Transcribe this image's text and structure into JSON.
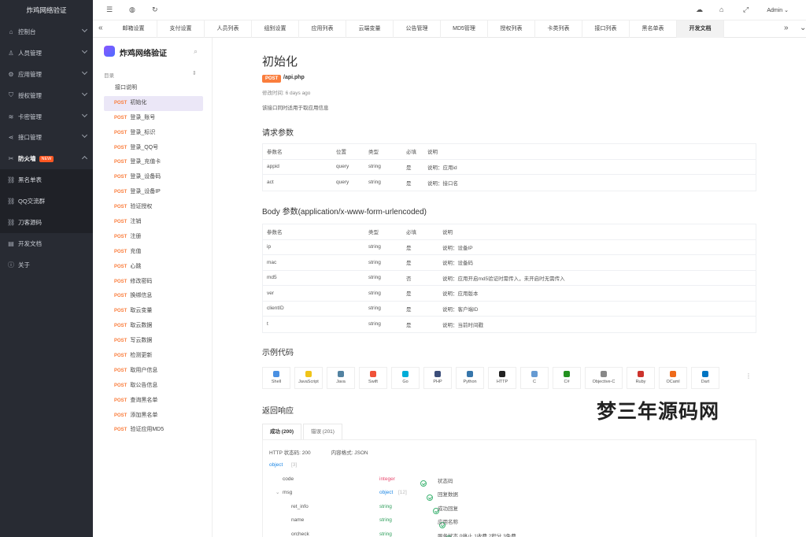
{
  "sidebar": {
    "brand": "炸鸡网络验证",
    "items": [
      {
        "label": "控制台",
        "icon": "home-icon",
        "expand": "down"
      },
      {
        "label": "人员管理",
        "icon": "user-icon",
        "expand": "down"
      },
      {
        "label": "应用管理",
        "icon": "gear-icon",
        "expand": "down"
      },
      {
        "label": "授权管理",
        "icon": "shield-icon",
        "expand": "down"
      },
      {
        "label": "卡密管理",
        "icon": "layers-icon",
        "expand": "down"
      },
      {
        "label": "接口管理",
        "icon": "share-icon",
        "expand": "down"
      },
      {
        "label": "防火墙",
        "icon": "scissors-icon",
        "expand": "up",
        "badge": "NEW",
        "active": true
      },
      {
        "label": "黑名单表",
        "icon": "link-icon",
        "sub": true
      },
      {
        "label": "QQ交流群",
        "icon": "link-icon",
        "sub": true
      },
      {
        "label": "刀客源码",
        "icon": "link-icon",
        "sub": true
      },
      {
        "label": "开发文档",
        "icon": "book-icon"
      },
      {
        "label": "关于",
        "icon": "info-icon"
      }
    ]
  },
  "topbar": {
    "admin": "Admin"
  },
  "tabs": [
    "邮箱设置",
    "支付设置",
    "人员列表",
    "组别设置",
    "应用列表",
    "云端变量",
    "公告管理",
    "MD5管理",
    "授权列表",
    "卡类列表",
    "接口列表",
    "黑名单表",
    "开发文档"
  ],
  "active_tab": "开发文档",
  "docnav": {
    "name": "炸鸡网络验证",
    "dir": "目录",
    "intro": "接口说明",
    "method": "POST",
    "items": [
      "初始化",
      "登录_账号",
      "登录_标识",
      "登录_QQ号",
      "登录_充值卡",
      "登录_设备码",
      "登录_设备IP",
      "验证授权",
      "注销",
      "注册",
      "充值",
      "心跳",
      "修改密码",
      "换绑信息",
      "取云变量",
      "取云数据",
      "写云数据",
      "检测更新",
      "取用户信息",
      "取公告信息",
      "查询黑名单",
      "添加黑名单",
      "验证应用MD5"
    ],
    "selected": "初始化"
  },
  "main": {
    "title": "初始化",
    "method": "POST",
    "path": "/api.php",
    "modified": "修改时间: 6 days ago",
    "desc": "该接口同时适用于取应用信息",
    "req_title": "请求参数",
    "req_headers": [
      "参数名",
      "位置",
      "类型",
      "必填",
      "说明"
    ],
    "req_rows": [
      [
        "appid",
        "query",
        "string",
        "是",
        "说明：应用id"
      ],
      [
        "act",
        "query",
        "string",
        "是",
        "说明：接口名"
      ]
    ],
    "body_title": "Body 参数(application/x-www-form-urlencoded)",
    "body_headers": [
      "参数名",
      "类型",
      "必填",
      "说明"
    ],
    "body_rows": [
      [
        "ip",
        "string",
        "是",
        "说明：设备IP"
      ],
      [
        "mac",
        "string",
        "是",
        "说明：设备码"
      ],
      [
        "md5",
        "string",
        "否",
        "说明：应用开启md5验证时需传入，未开启时无需传入"
      ],
      [
        "ver",
        "string",
        "是",
        "说明：应用版本"
      ],
      [
        "clientID",
        "string",
        "是",
        "说明：客户端ID"
      ],
      [
        "t",
        "string",
        "是",
        "说明：当前时间戳"
      ]
    ],
    "sample_title": "示例代码",
    "samples": [
      {
        "label": "Shell",
        "color": "#4a90e2"
      },
      {
        "label": "JavaScript",
        "color": "#f0c419"
      },
      {
        "label": "Java",
        "color": "#5382a1"
      },
      {
        "label": "Swift",
        "color": "#f05138"
      },
      {
        "label": "Go",
        "color": "#00add8"
      },
      {
        "label": "PHP",
        "color": "#3c4e7a"
      },
      {
        "label": "Python",
        "color": "#3776ab"
      },
      {
        "label": "HTTP",
        "color": "#222222"
      },
      {
        "label": "C",
        "color": "#659ad2"
      },
      {
        "label": "C#",
        "color": "#239120"
      },
      {
        "label": "Objective-C",
        "color": "#888888"
      },
      {
        "label": "Ruby",
        "color": "#cc342d"
      },
      {
        "label": "OCaml",
        "color": "#ee6a1a"
      },
      {
        "label": "Dart",
        "color": "#0175c2"
      }
    ],
    "resp_title": "返回响应",
    "resp_tabs": [
      "成功 (200)",
      "错误 (201)"
    ],
    "resp_meta": "HTTP 状态码: 200",
    "resp_format": "内容格式: JSON",
    "resp_rows": [
      {
        "name": "object",
        "count": "[3]",
        "type": "",
        "desc": "",
        "indent": 0
      },
      {
        "name": "code",
        "type": "integer",
        "desc": "状态码",
        "indent": 1
      },
      {
        "name": "msg",
        "type": "object",
        "count": "[12]",
        "desc": "回复数据",
        "indent": 1
      },
      {
        "name": "ret_info",
        "type": "string",
        "desc": "成功回复",
        "indent": 2
      },
      {
        "name": "name",
        "type": "string",
        "desc": "应用名称",
        "indent": 2
      },
      {
        "name": "orcheck",
        "type": "string",
        "desc": "服务状态  0停止 1收费 2积分 3免费",
        "indent": 2
      }
    ]
  },
  "watermark": "梦三年源码网"
}
